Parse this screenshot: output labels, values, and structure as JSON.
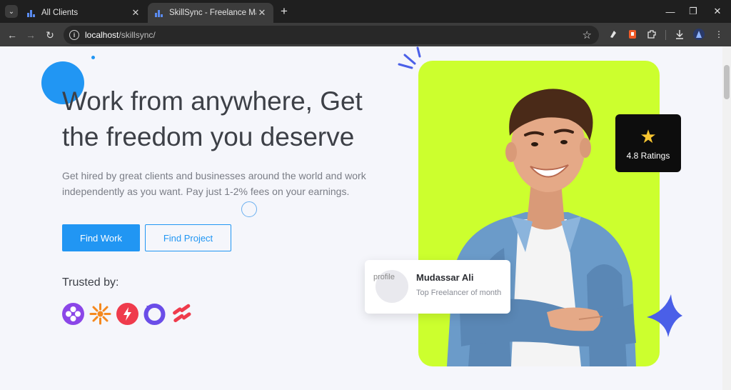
{
  "browser": {
    "tabs": [
      {
        "title": "All Clients",
        "active": false
      },
      {
        "title": "SkillSync - Freelance Marketplace",
        "active": true
      }
    ],
    "url_host": "localhost",
    "url_path": "/skillsync/"
  },
  "hero": {
    "headline": "Work from anywhere, Get the freedom you deserve",
    "subtitle": "Get hired by great clients and businesses around the world and work independently as you want. Pay just 1-2% fees on your earnings.",
    "primary_button": "Find Work",
    "secondary_button": "Find Project"
  },
  "trusted": {
    "label": "Trusted by:",
    "logos": [
      "purple-flower-logo",
      "orange-sun-logo",
      "red-bolt-logo",
      "violet-ring-logo",
      "red-ribbon-logo"
    ]
  },
  "rating_card": {
    "icon": "star-icon",
    "text": "4.8 Ratings"
  },
  "profile_card": {
    "avatar_alt": "profile",
    "name": "Mudassar Ali",
    "role": "Top Freelancer of month"
  },
  "colors": {
    "accent": "#2196f3",
    "hero_bg": "#ccff2e",
    "headline": "#3d4047",
    "sparkle": "#4a5fe8"
  }
}
